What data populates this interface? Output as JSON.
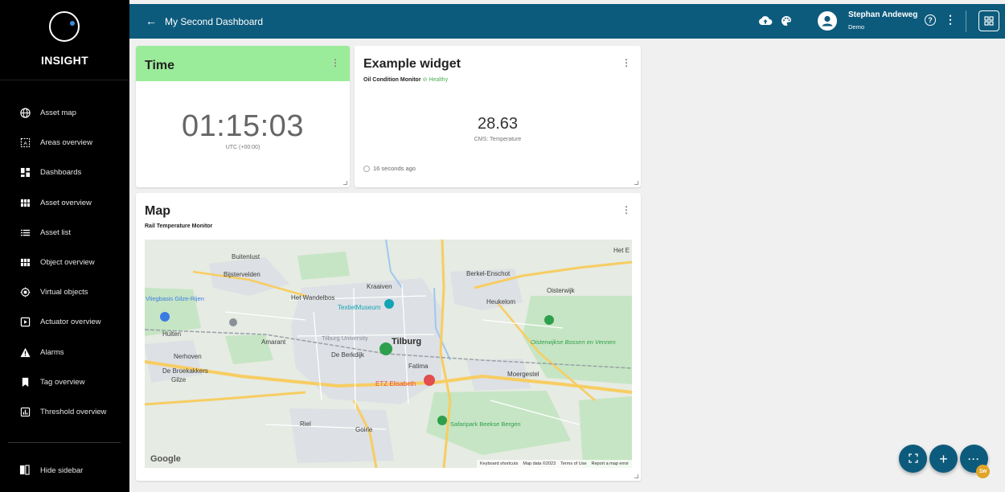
{
  "brand": {
    "name": "INSIGHT"
  },
  "sidebar": {
    "items": [
      {
        "label": "Asset map",
        "icon": "globe-icon"
      },
      {
        "label": "Areas overview",
        "icon": "area-icon"
      },
      {
        "label": "Dashboards",
        "icon": "dashboard-icon"
      },
      {
        "label": "Asset overview",
        "icon": "grid-icon"
      },
      {
        "label": "Asset list",
        "icon": "list-icon"
      },
      {
        "label": "Object overview",
        "icon": "grid-icon"
      },
      {
        "label": "Virtual objects",
        "icon": "chip-icon"
      },
      {
        "label": "Actuator overview",
        "icon": "actuator-icon"
      },
      {
        "label": "Alarms",
        "icon": "warning-icon"
      },
      {
        "label": "Tag overview",
        "icon": "bookmark-icon"
      },
      {
        "label": "Threshold overview",
        "icon": "bar-chart-icon"
      }
    ],
    "hide_label": "Hide sidebar"
  },
  "topbar": {
    "title": "My Second Dashboard",
    "user_name": "Stephan Andeweg",
    "user_role": "Demo"
  },
  "widgets": {
    "time": {
      "title": "Time",
      "value": "01:15:03",
      "timezone": "UTC (+00:00)",
      "header_color": "#9bec9a"
    },
    "example": {
      "title": "Example widget",
      "subtitle": "Oil Condition Monitor",
      "status": "Healthy",
      "value": "28.63",
      "label": "CMS: Temperature",
      "updated": "16 seconds ago"
    },
    "map": {
      "title": "Map",
      "subtitle": "Rail Temperature Monitor",
      "labels": {
        "tilburg": "Tilburg",
        "buitenlust": "Buitenlust",
        "bijstervelden": "Bijstervelden",
        "kraaiven": "Kraaiven",
        "berkel": "Berkel-Enschot",
        "oisterwijk": "Oisterwijk",
        "heukelom": "Heukelom",
        "wandelbos": "Het Wandelbos",
        "textiel": "TextielMuseum",
        "vliegbasis": "Vliegbasis Gilze-Rijen",
        "hulten": "Hulten",
        "amarant": "Amarant",
        "univ": "Tilburg University",
        "nerhoven": "Nerhoven",
        "berkdijk": "De Berkdijk",
        "broekakkers": "De Broekakkers",
        "gilze": "Gilze",
        "fatima": "Fatima",
        "etz": "ETZ Elisabeth",
        "moergestel": "Moergestel",
        "oisterwijkse": "Oisterwijkse Bossen en Vennen",
        "riel": "Riel",
        "goirle": "Goirle",
        "safari": "Safaripark Beekse Bergen",
        "hetE": "Het E"
      },
      "attribution": {
        "google": "Google",
        "shortcuts": "Keyboard shortcuts",
        "mapdata": "Map data ©2023",
        "terms": "Terms of Use",
        "report": "Report a map error"
      }
    }
  },
  "fab": {
    "badge": "1w"
  },
  "colors": {
    "primary": "#0d5b7c",
    "sidebar": "#000000",
    "healthy": "#4caf50"
  }
}
